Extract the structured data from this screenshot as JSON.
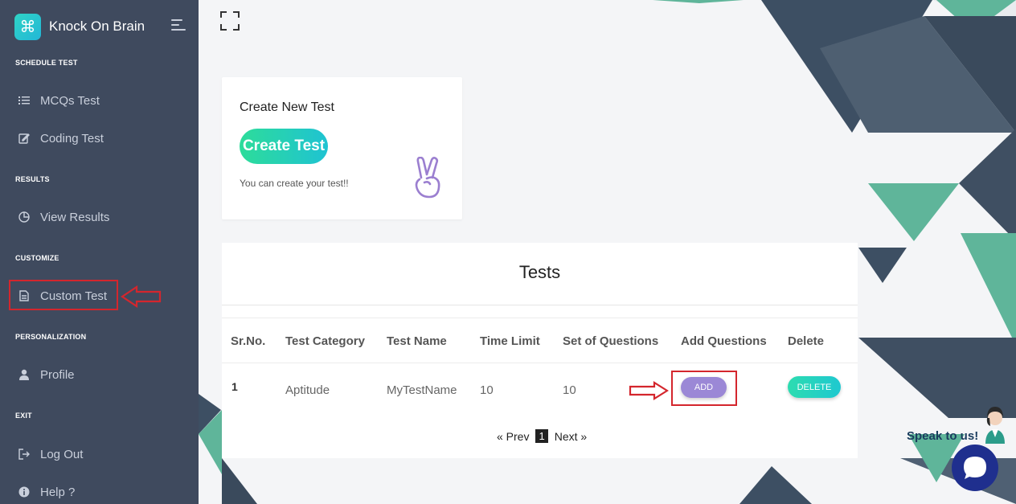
{
  "sidebar": {
    "brand": {
      "logo_glyph": "⌘",
      "name": "Knock On Brain"
    },
    "sections": [
      {
        "title": "SCHEDULE TEST"
      },
      {
        "title": "RESULTS"
      },
      {
        "title": "CUSTOMIZE"
      },
      {
        "title": "PERSONALIZATION"
      },
      {
        "title": "EXIT"
      }
    ],
    "items": [
      {
        "label": "MCQs Test",
        "icon": "list-icon"
      },
      {
        "label": "Coding Test",
        "icon": "edit-icon"
      },
      {
        "label": "View Results",
        "icon": "pie-chart-icon"
      },
      {
        "label": "Custom Test",
        "icon": "document-icon"
      },
      {
        "label": "Profile",
        "icon": "user-icon"
      },
      {
        "label": "Log Out",
        "icon": "logout-icon"
      },
      {
        "label": "Help ?",
        "icon": "info-icon"
      }
    ]
  },
  "create_card": {
    "title": "Create New Test",
    "button_label": "Create Test",
    "subtitle": "You can create your test!!"
  },
  "tests": {
    "title": "Tests",
    "columns": [
      "Sr.No.",
      "Test Category",
      "Test Name",
      "Time Limit",
      "Set of Questions",
      "Add Questions",
      "Delete"
    ],
    "rows": [
      {
        "sr": "1",
        "category": "Aptitude",
        "name": "MyTestName",
        "time_limit": "10",
        "set_of_questions": "10",
        "add_label": "ADD",
        "delete_label": "DELETE"
      }
    ],
    "pagination": {
      "prev": "« Prev",
      "current": "1",
      "next": "Next »"
    }
  },
  "chat": {
    "label": "Speak to us!"
  },
  "colors": {
    "sidebar_bg": "#3f4a5e",
    "accent_teal": "#22c5c7",
    "add_button": "#9b88d6",
    "annotation_red": "#d4262d",
    "chat_button": "#1f2f8e"
  }
}
